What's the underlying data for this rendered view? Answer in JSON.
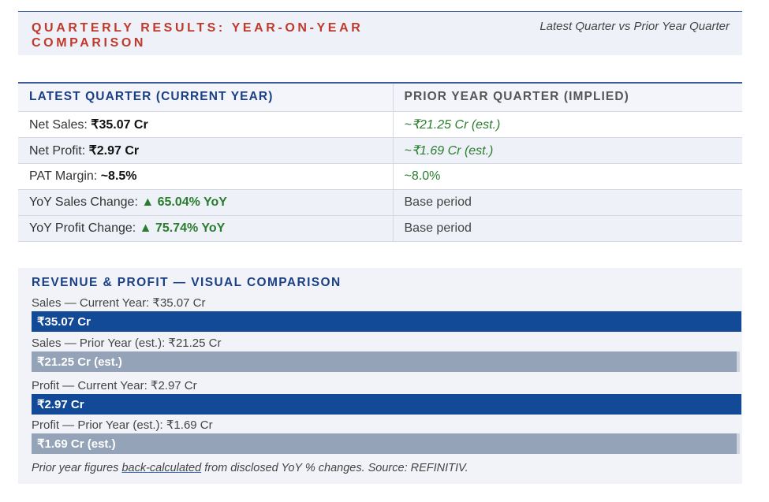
{
  "header": {
    "title": "QUARTERLY RESULTS: YEAR-ON-YEAR COMPARISON",
    "subtitle": "Latest Quarter vs Prior Year Quarter"
  },
  "table": {
    "col_current": "LATEST QUARTER (CURRENT YEAR)",
    "col_prior": "PRIOR YEAR QUARTER (IMPLIED)",
    "rows": [
      {
        "label": "Net Sales: ",
        "current": "₹35.07 Cr",
        "prior": "~₹21.25 Cr (est.)"
      },
      {
        "label": "Net Profit: ",
        "current": "₹2.97 Cr",
        "prior": "~₹1.69 Cr (est.)"
      },
      {
        "label": "PAT Margin: ",
        "current": "~8.5%",
        "prior": "~8.0%"
      },
      {
        "label": "YoY Sales Change: ",
        "current": "▲ 65.04% YoY",
        "prior": "Base period"
      },
      {
        "label": "YoY Profit Change: ",
        "current": "▲ 75.74% YoY",
        "prior": "Base period"
      }
    ]
  },
  "visual": {
    "title": "REVENUE & PROFIT — VISUAL COMPARISON",
    "bars": [
      {
        "label": "Sales — Current Year: ₹35.07 Cr",
        "bar_text": "₹35.07 Cr",
        "value": 35.07,
        "kind": "current",
        "group": "sales"
      },
      {
        "label": "Sales — Prior Year (est.): ₹21.25 Cr",
        "bar_text": "₹21.25 Cr (est.)",
        "value": 21.25,
        "kind": "prior",
        "group": "sales"
      },
      {
        "label": "Profit — Current Year: ₹2.97 Cr",
        "bar_text": "₹2.97 Cr",
        "value": 2.97,
        "kind": "current",
        "group": "profit"
      },
      {
        "label": "Profit — Prior Year (est.): ₹1.69 Cr",
        "bar_text": "₹1.69 Cr (est.)",
        "value": 1.69,
        "kind": "prior",
        "group": "profit"
      }
    ],
    "footnote_pre": "Prior year figures ",
    "footnote_link": "back-calculated",
    "footnote_post": " from disclosed YoY % changes. Source: REFINITIV."
  }
}
